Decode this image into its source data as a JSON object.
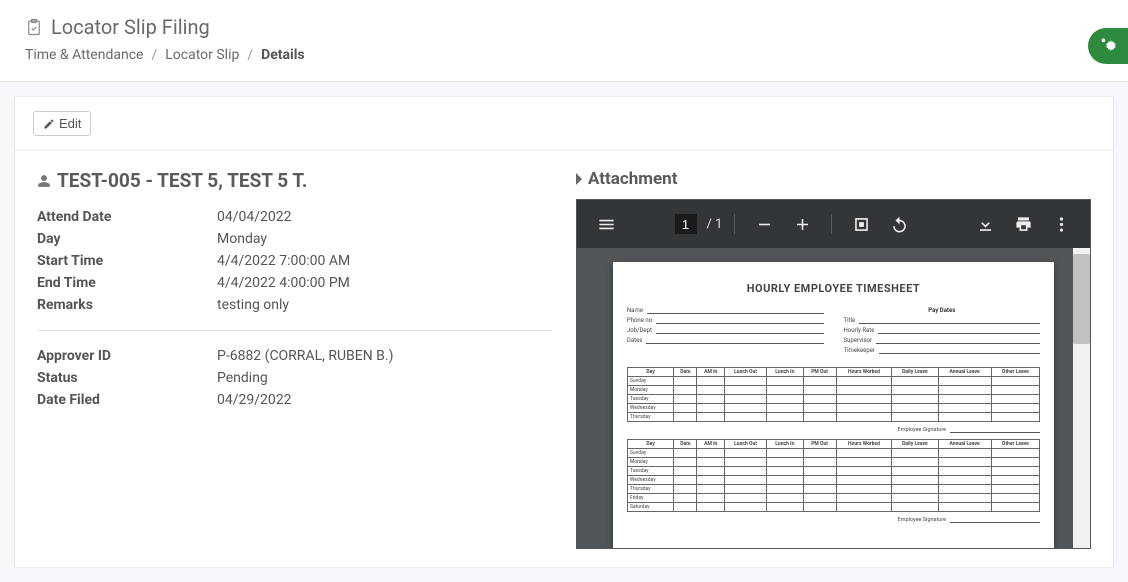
{
  "header": {
    "title": "Locator Slip Filing",
    "breadcrumb": {
      "item1": "Time & Attendance",
      "item2": "Locator Slip",
      "current": "Details"
    }
  },
  "toolbar": {
    "edit_label": "Edit"
  },
  "employee": {
    "display": "TEST-005 - TEST 5, TEST 5 T."
  },
  "details": {
    "attend_date": {
      "label": "Attend Date",
      "value": "04/04/2022"
    },
    "day": {
      "label": "Day",
      "value": "Monday"
    },
    "start_time": {
      "label": "Start Time",
      "value": "4/4/2022 7:00:00 AM"
    },
    "end_time": {
      "label": "End Time",
      "value": "4/4/2022 4:00:00 PM"
    },
    "remarks": {
      "label": "Remarks",
      "value": "testing only"
    },
    "approver_id": {
      "label": "Approver ID",
      "value": "P-6882 (CORRAL, RUBEN B.)"
    },
    "status": {
      "label": "Status",
      "value": "Pending"
    },
    "date_filed": {
      "label": "Date Filed",
      "value": "04/29/2022"
    }
  },
  "attachment": {
    "title": "Attachment"
  },
  "pdf": {
    "page_current": "1",
    "page_total": "/  1",
    "doc_title": "HOURLY EMPLOYEE TIMESHEET",
    "left_fields": [
      "Name",
      "Phone no",
      "Job/Dept",
      "Dates"
    ],
    "right_title": "Pay Dates",
    "right_fields": [
      "Title",
      "Hourly Rate",
      "Supervisor",
      "Timekeeper"
    ],
    "table_headers": [
      "Day",
      "Date",
      "AM In",
      "Lunch Out",
      "Lunch In",
      "PM Out",
      "Hours Worked",
      "Daily Leave",
      "Annual Leave",
      "Other Leave"
    ],
    "table_rows": [
      "Sunday",
      "Monday",
      "Tuesday",
      "Wednesday",
      "Thursday",
      "Friday",
      "Saturday"
    ],
    "sig_label": "Employee Signature"
  }
}
